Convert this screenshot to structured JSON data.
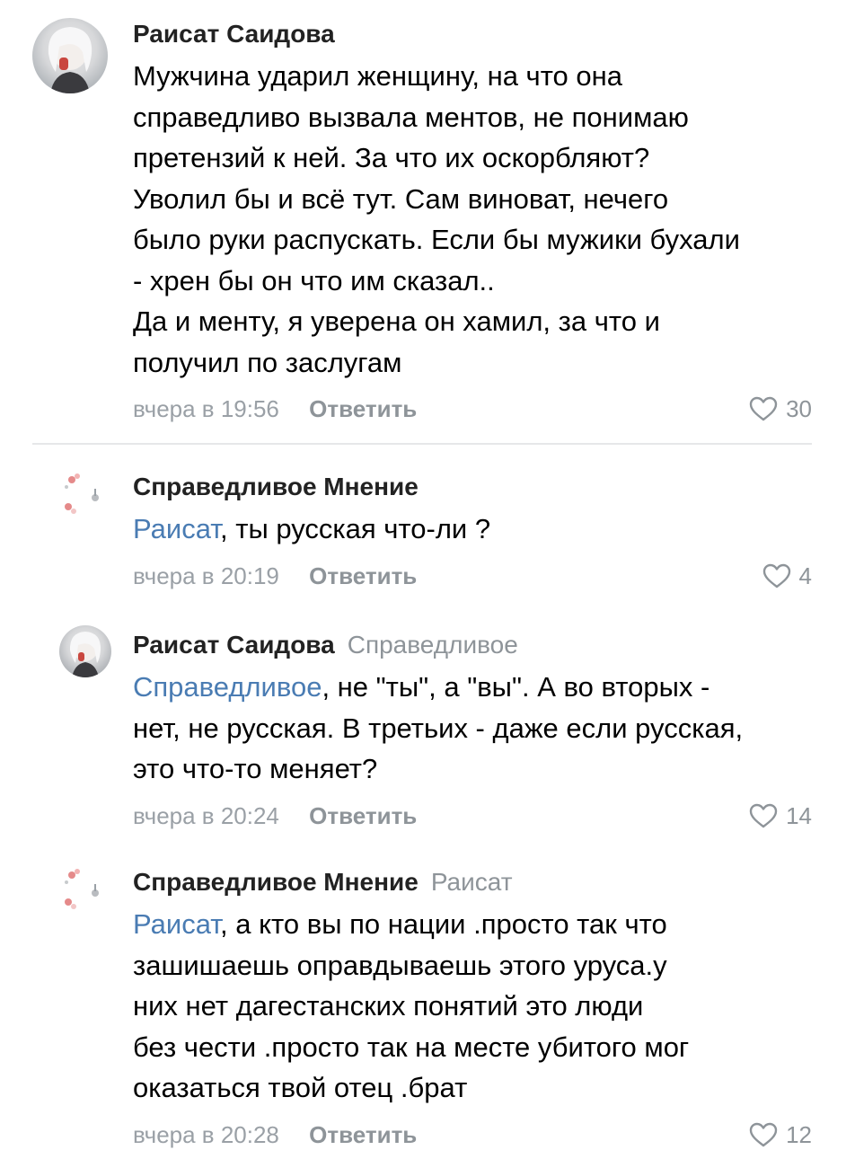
{
  "comments": [
    {
      "author": "Раисат Саидова",
      "reply_to": "",
      "mention": "",
      "text_lines": [
        "Мужчина ударил женщину, на что она",
        "справедливо вызвала ментов, не понимаю",
        "претензий к ней. За что их оскорбляют?",
        "Уволил бы и всё тут. Сам виноват, нечего",
        "было руки распускать. Если бы мужики бухали",
        "- хрен бы он что им сказал..",
        "Да и менту, я уверена он хамил, за что и",
        "получил по заслугам"
      ],
      "date": "вчера в 19:56",
      "reply_label": "Ответить",
      "likes": "30",
      "avatar": "photo-avatar"
    },
    {
      "author": "Справедливое Мнение",
      "reply_to": "",
      "mention": "Раисат",
      "text_lines": [
        ", ты русская что-ли ?"
      ],
      "date": "вчера в 20:19",
      "reply_label": "Ответить",
      "likes": "4",
      "avatar": "flowers-avatar"
    },
    {
      "author": "Раисат Саидова",
      "reply_to": "Справедливое",
      "mention": "Справедливое",
      "text_lines": [
        ", не \"ты\", а \"вы\". А во вторых -",
        "нет, не русская. В третьих - даже если русская,",
        "это что-то меняет?"
      ],
      "date": "вчера в 20:24",
      "reply_label": "Ответить",
      "likes": "14",
      "avatar": "photo-avatar"
    },
    {
      "author": "Справедливое Мнение",
      "reply_to": "Раисат",
      "mention": "Раисат",
      "text_lines": [
        ", а кто вы по нации .просто так что",
        "зашишаешь оправдываешь этого уруса.у",
        "них нет дагестанских понятий это люди",
        "без чести .просто так на месте убитого мог",
        "оказаться твой отец .брат"
      ],
      "date": "вчера в 20:28",
      "reply_label": "Ответить",
      "likes": "12",
      "avatar": "flowers-avatar"
    }
  ],
  "icons": {
    "like": "heart-outline-icon"
  },
  "colors": {
    "mention": "#4a7cb3",
    "meta": "#9aa0a6",
    "divider": "#e6e7e9"
  }
}
